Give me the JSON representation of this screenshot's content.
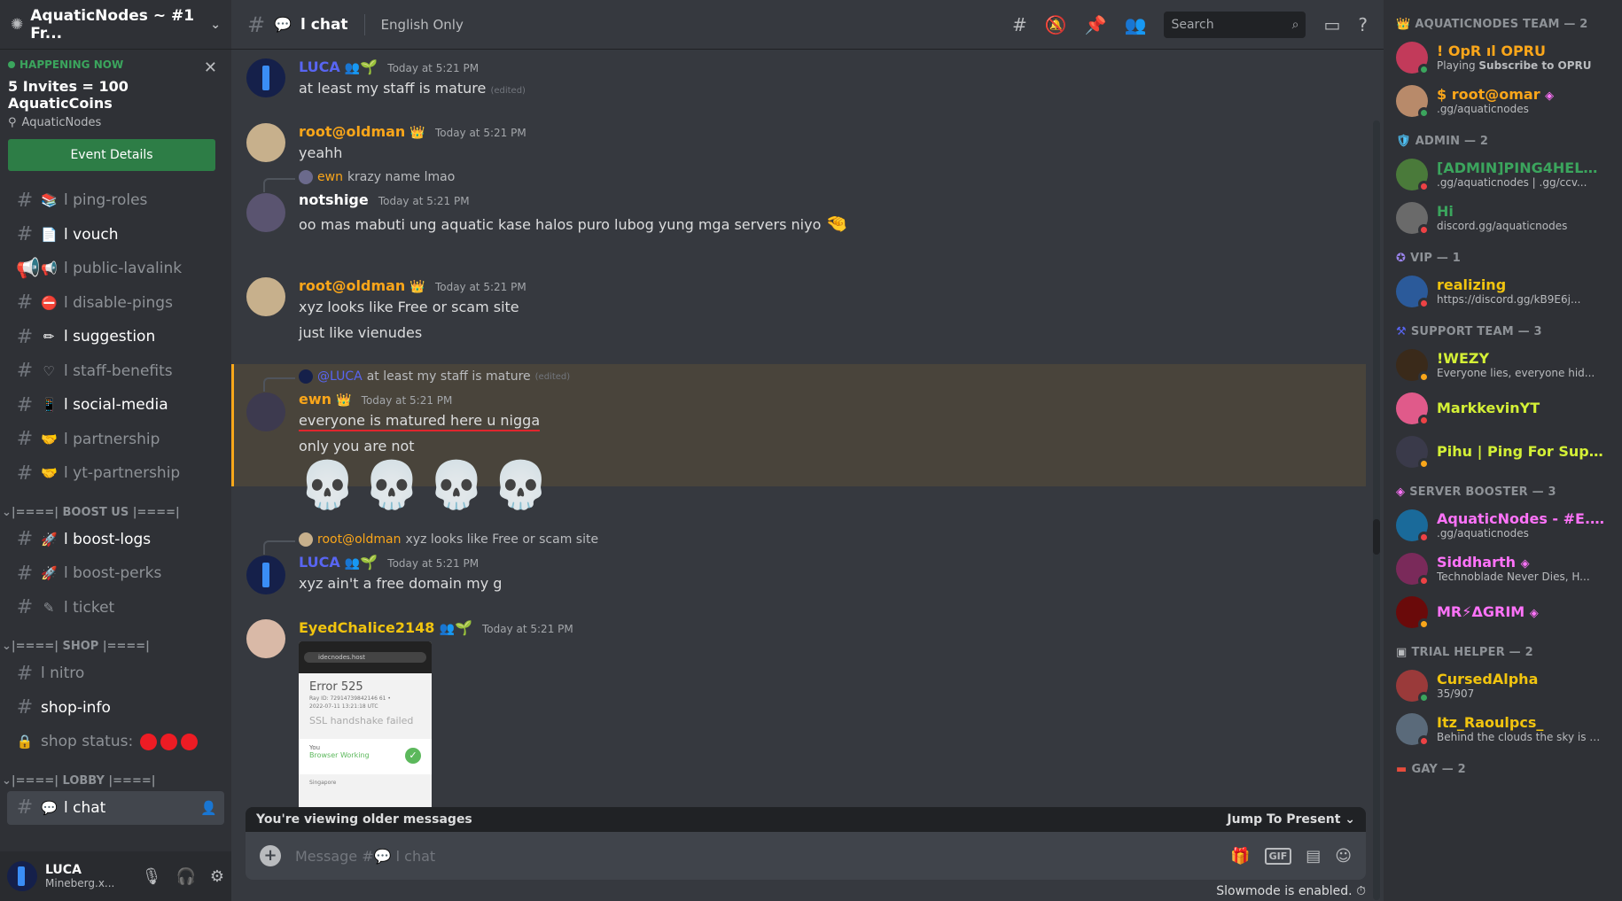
{
  "server": {
    "name": "AquaticNodes ~ #1 Fr...",
    "icon": "server-icon"
  },
  "event": {
    "status": "HAPPENING NOW",
    "title": "5 Invites = 100 AquaticCoins",
    "location": "AquaticNodes",
    "button": "Event Details"
  },
  "channels": [
    {
      "emoji": "📚",
      "label": "l ping-roles",
      "bright": false
    },
    {
      "emoji": "📄",
      "label": "l vouch",
      "bright": true
    },
    {
      "emoji": "📢",
      "label": "l public-lavalink",
      "bright": false
    },
    {
      "emoji": "⛔",
      "label": "l disable-pings",
      "bright": false
    },
    {
      "emoji": "✏",
      "label": "l suggestion",
      "bright": true
    },
    {
      "emoji": "♡",
      "label": "l staff-benefits",
      "bright": false
    },
    {
      "emoji": "📱",
      "label": "l social-media",
      "bright": true
    },
    {
      "emoji": "🤝",
      "label": "l partnership",
      "bright": false
    },
    {
      "emoji": "🤝",
      "label": "l yt-partnership",
      "bright": false
    }
  ],
  "cat_boost": "|====| BOOST US |====|",
  "boost_channels": [
    {
      "emoji": "🚀",
      "label": "l boost-logs",
      "bright": true
    },
    {
      "emoji": "🚀",
      "label": "l boost-perks",
      "bright": false
    },
    {
      "emoji": "✎",
      "label": "l ticket",
      "bright": false
    }
  ],
  "cat_shop": "|====| SHOP |====|",
  "shop_channels": {
    "nitro": "l nitro",
    "shop_info": "shop-info",
    "shop_status": "shop status:"
  },
  "cat_lobby": "|====| LOBBY |====|",
  "active_channel": "l chat",
  "user": {
    "name": "LUCA",
    "status": "Mineberg.x..."
  },
  "topbar": {
    "channel": "l chat",
    "topic": "English Only",
    "search_placeholder": "Search"
  },
  "messages": {
    "m1": {
      "author": "LUCA",
      "time": "Today at 5:21 PM",
      "text": "at least my staff is mature",
      "edited": "(edited)"
    },
    "m2": {
      "author": "root@oldman",
      "time": "Today at 5:21 PM",
      "text": "yeahh"
    },
    "m3": {
      "reply_author": "ewn",
      "reply_text": "krazy name lmao",
      "author": "notshige",
      "time": "Today at 5:21 PM",
      "text": "oo mas mabuti ung aquatic kase halos puro lubog yung mga servers niyo"
    },
    "m4": {
      "author": "root@oldman",
      "time": "Today at 5:21 PM",
      "text1": "xyz looks like Free or scam site",
      "text2": "just like vienudes"
    },
    "m5": {
      "reply_author": "@LUCA",
      "reply_text": "at least my staff is mature",
      "reply_edited": "(edited)",
      "author": "ewn",
      "time": "Today at 5:21 PM",
      "text1": "everyone is matured here u nigga",
      "text2": "only you are not"
    },
    "m6": {
      "reply_author": "root@oldman",
      "reply_text": "xyz looks like Free or scam site",
      "author": "LUCA",
      "time": "Today at 5:21 PM",
      "text": "xyz ain't a free domain my g"
    },
    "m7": {
      "author": "EyedChalice2148",
      "time": "Today at 5:21 PM",
      "image": {
        "url": "idecnodes.host",
        "error": "Error 525",
        "ray": "Ray ID: 72914739842146 61 •",
        "date": "2022-07-11 13:21:18 UTC",
        "fail": "SSL handshake failed",
        "you": "You",
        "browser": "Browser Working",
        "loc": "Singapore"
      }
    }
  },
  "older_bar": {
    "text": "You're viewing older messages",
    "jump": "Jump To Present"
  },
  "composer": {
    "placeholder": "Message #💬 l chat",
    "gif": "GIF"
  },
  "slowmode": "Slowmode is enabled.",
  "member_roles": {
    "team": "AQUATICNODES TEAM — 2",
    "admin": "ADMIN — 2",
    "vip": "VIP — 1",
    "support": "SUPPORT TEAM — 3",
    "booster": "SERVER BOOSTER — 3",
    "trial": "TRIAL HELPER — 2",
    "gay": "GAY — 2"
  },
  "members": {
    "opru": {
      "name": "! OpR ıl OPRU",
      "sub_pre": "Playing ",
      "sub": "Subscribe to OPRU"
    },
    "omar": {
      "name": "$ root@omar",
      "sub": ".gg/aquaticnodes"
    },
    "ping4help": {
      "name": "[ADMIN]PING4HELP",
      "sub": ".gg/aquaticnodes | .gg/ccv..."
    },
    "hi": {
      "name": "Hi",
      "sub": "discord.gg/aquaticnodes"
    },
    "realizing": {
      "name": "realizing",
      "sub": "https://discord.gg/kB9E6j..."
    },
    "wezy": {
      "name": "!WEZY",
      "sub": "Everyone lies, everyone hid..."
    },
    "markkevin": {
      "name": "MarkkevinYT",
      "sub": ""
    },
    "pihu": {
      "name": "Pihu | Ping For Supp...",
      "sub": ""
    },
    "aquaticnodes": {
      "name": "AquaticNodes - #E...",
      "sub": ".gg/aquaticnodes"
    },
    "siddharth": {
      "name": "Siddharth",
      "sub": "Technoblade Never Dies, H..."
    },
    "agrim": {
      "name": "MR⚡ΔGRIM",
      "sub": ""
    },
    "cursedalpha": {
      "name": "CursedAlpha",
      "sub": "35/907"
    },
    "raoulpcs": {
      "name": "Itz_Raoulpcs_",
      "sub": "Behind the clouds the sky is al..."
    }
  },
  "colors": {
    "luca": "#5865f2",
    "root": "#faa61a",
    "ewn": "#faa61a",
    "notshige": "#ffffff",
    "eyed": "#f1c40f",
    "admin": "#3ba55d",
    "booster": "#ff73fa",
    "support": "#d4f036"
  }
}
